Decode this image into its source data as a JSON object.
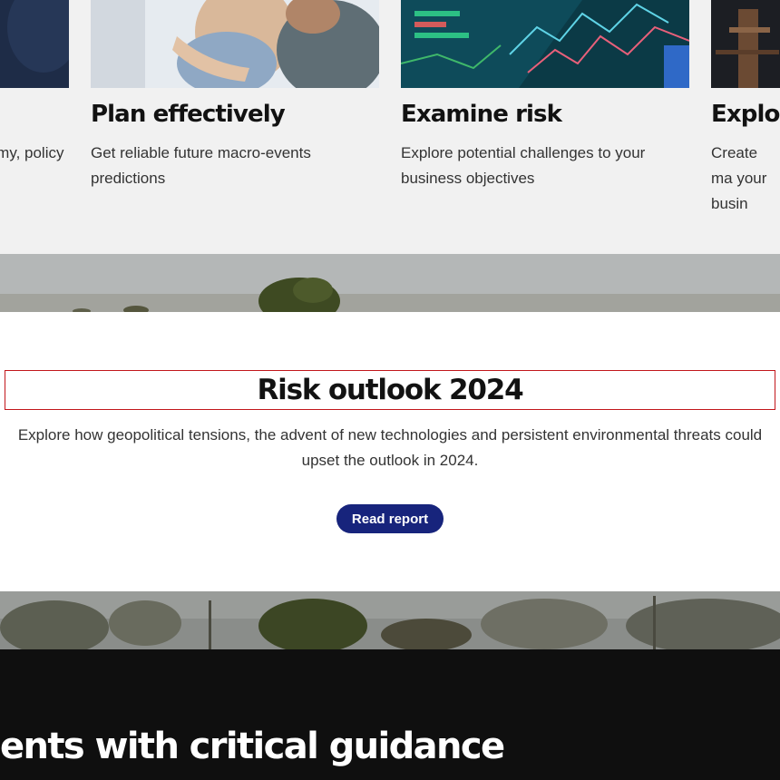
{
  "cards": [
    {
      "title": "",
      "description": "Get accurate data on the economy, policy and",
      "image": "business-people-photo"
    },
    {
      "title": "Plan effectively",
      "description": "Get reliable future macro-events predictions",
      "image": "team-meeting-photo"
    },
    {
      "title": "Examine risk",
      "description": "Explore potential challenges to your business objectives",
      "image": "trading-screen-photo"
    },
    {
      "title": "Explor",
      "description": "Create ma your busin",
      "image": "industrial-photo"
    }
  ],
  "risk_outlook": {
    "title": "Risk outlook 2024",
    "description": "Explore how geopolitical tensions, the advent of new technologies and persistent environmental threats could upset the outlook in 2024.",
    "button_label": "Read report"
  },
  "dark_section": {
    "heading": "ents with critical guidance"
  },
  "colors": {
    "button_bg": "#17247c",
    "title_outline": "#c2161b",
    "dark_bg": "#0f0f0f",
    "cards_bg": "#f1f1f1"
  }
}
